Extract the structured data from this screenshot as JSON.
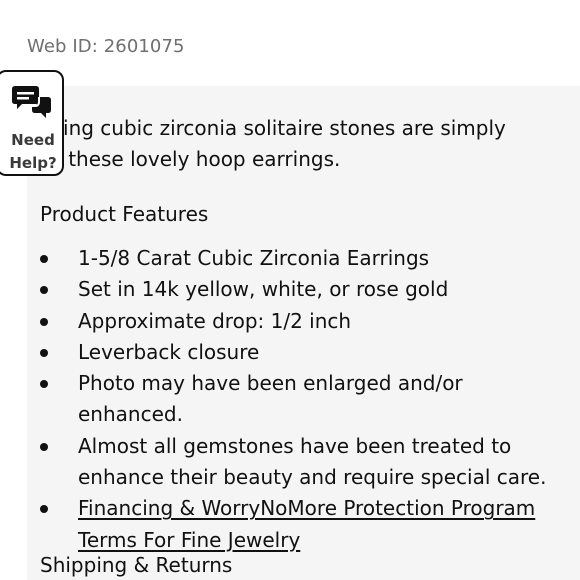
{
  "web_id": "Web ID: 2601075",
  "description": {
    "line1": "Sparkling cubic zirconia solitaire stones are simply",
    "line2": "set on these lovely hoop earrings."
  },
  "features": {
    "heading": "Product Features",
    "items": [
      "1-5/8 Carat Cubic Zirconia Earrings",
      "Set in 14k yellow, white, or rose gold",
      "Approximate drop: 1/2 inch",
      "Leverback closure",
      "Photo may have been enlarged and/or enhanced.",
      "Almost all gemstones have been treated to enhance their beauty and require special care."
    ],
    "link_label": "Financing & WorryNoMore Protection Program Terms For Fine Jewelry"
  },
  "shipping": {
    "heading": "Shipping & Returns"
  },
  "help_widget": {
    "icon": "chat-bubbles-icon",
    "line1": "Need",
    "line2": "Help?"
  },
  "colors": {
    "panel_background": "#f5f5f5",
    "muted_text": "#6f6f6f",
    "text": "#111111"
  }
}
